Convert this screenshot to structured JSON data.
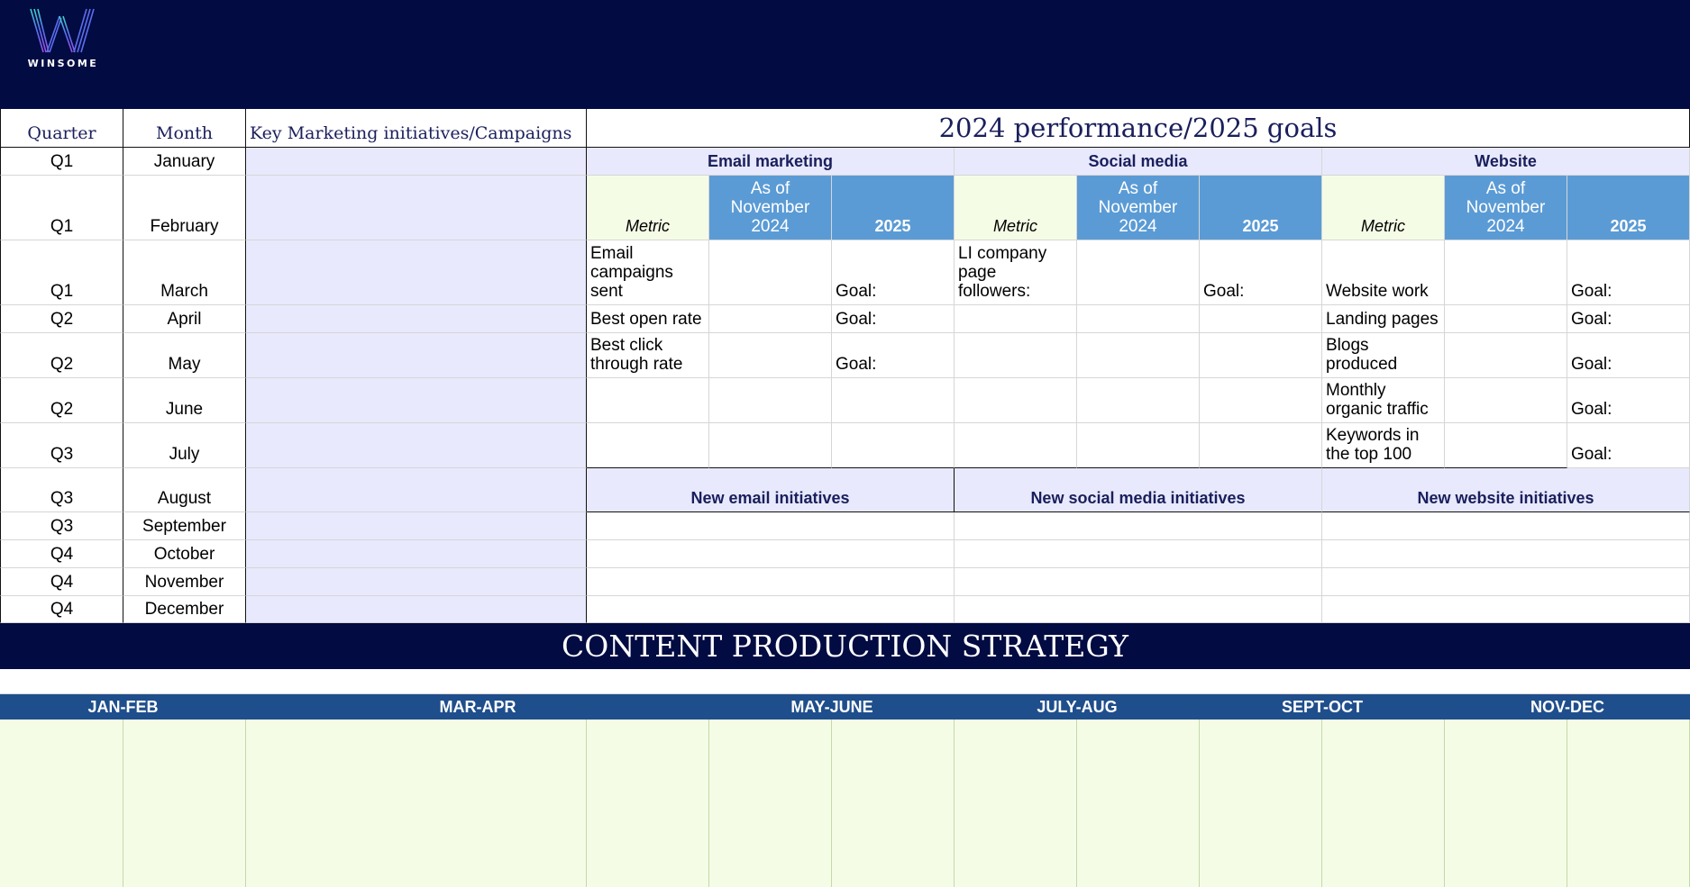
{
  "brand": {
    "name": "WINSOME"
  },
  "table": {
    "col_quarter": "Quarter",
    "col_month": "Month",
    "col_initiatives": "Key Marketing initiatives/Campaigns",
    "rows": [
      {
        "quarter": "Q1",
        "month": "January"
      },
      {
        "quarter": "Q1",
        "month": "February"
      },
      {
        "quarter": "Q1",
        "month": "March"
      },
      {
        "quarter": "Q2",
        "month": "April"
      },
      {
        "quarter": "Q2",
        "month": "May"
      },
      {
        "quarter": "Q2",
        "month": "June"
      },
      {
        "quarter": "Q3",
        "month": "July"
      },
      {
        "quarter": "Q3",
        "month": "August"
      },
      {
        "quarter": "Q3",
        "month": "September"
      },
      {
        "quarter": "Q4",
        "month": "October"
      },
      {
        "quarter": "Q4",
        "month": "November"
      },
      {
        "quarter": "Q4",
        "month": "December"
      }
    ]
  },
  "performance": {
    "title": "2024 performance/2025 goals",
    "sections": [
      "Email marketing",
      "Social media",
      "Website"
    ],
    "col_metric": "Metric",
    "col_as_of": "As of November 2024",
    "col_2025": "2025",
    "goal_label": "Goal:",
    "email_metrics": [
      "Email campaigns sent",
      "Best open rate",
      "Best click through rate"
    ],
    "social_metrics": [
      "LI company page followers:"
    ],
    "website_metrics": [
      "Website work",
      "Landing pages",
      "Blogs produced",
      "Monthly organic traffic",
      "Keywords in the top 100"
    ],
    "new_initiatives": [
      "New email initiatives",
      "New social media initiatives",
      "New website initiatives"
    ]
  },
  "content_strategy": {
    "title": "CONTENT PRODUCTION STRATEGY",
    "periods": [
      "JAN-FEB",
      "MAR-APR",
      "MAY-JUNE",
      "JULY-AUG",
      "SEPT-OCT",
      "NOV-DEC"
    ]
  },
  "colors": {
    "header_bg": "#020b42",
    "lavender": "#e8e9fc",
    "green": "#f4fce6",
    "blue": "#5b9bd5",
    "bimonth_bar": "#1f4e8c"
  }
}
